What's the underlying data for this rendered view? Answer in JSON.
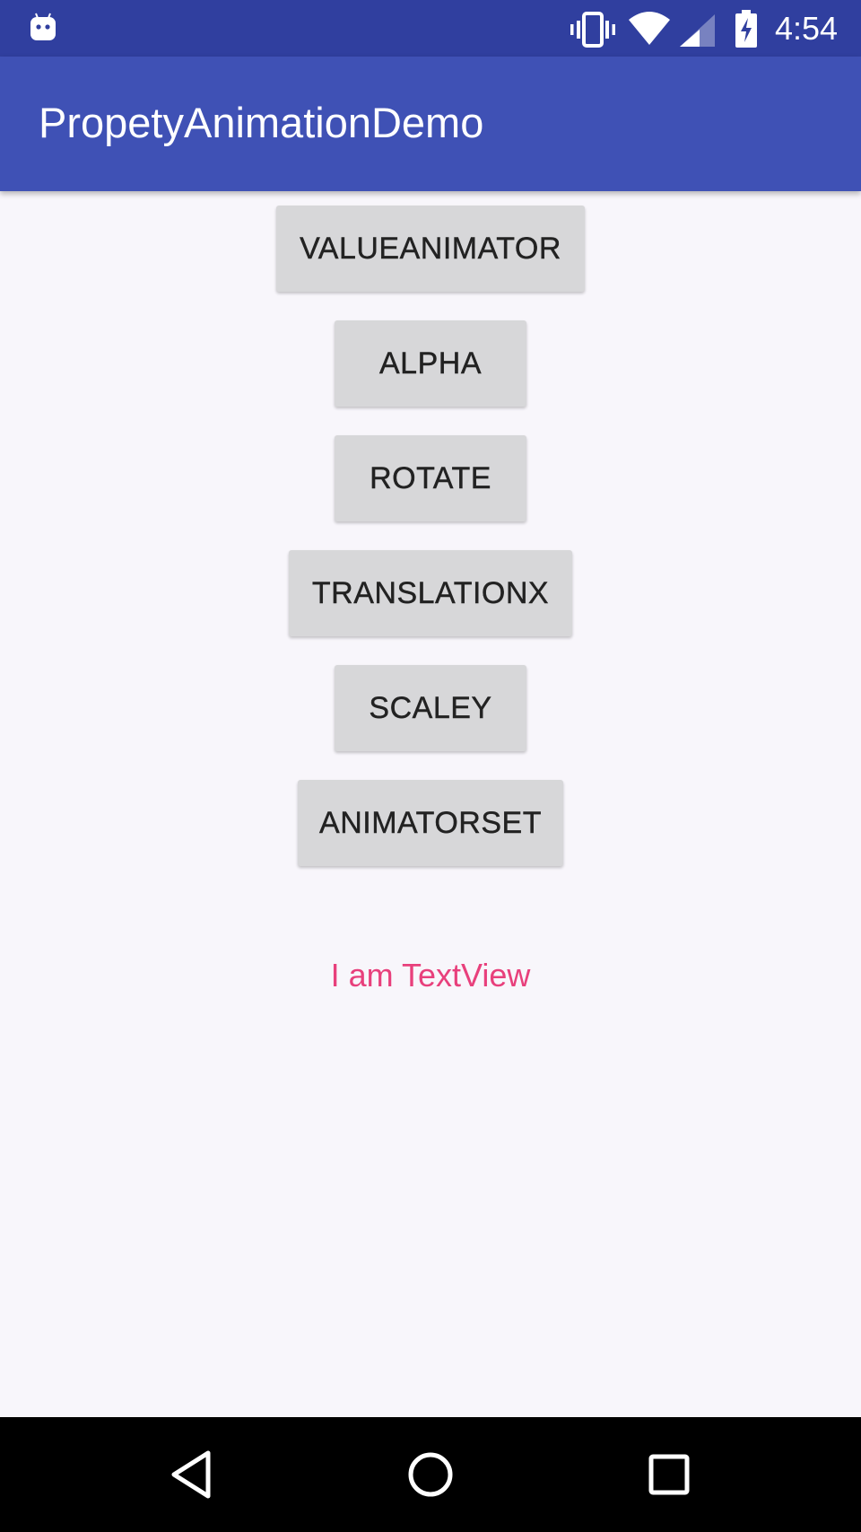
{
  "status_bar": {
    "time": "4:54",
    "icons": [
      "android-icon",
      "vibrate-icon",
      "wifi-icon",
      "signal-icon",
      "battery-charging-icon"
    ]
  },
  "app_bar": {
    "title": "PropetyAnimationDemo"
  },
  "buttons": {
    "value_animator": "VALUEANIMATOR",
    "alpha": "ALPHA",
    "rotate": "ROTATE",
    "translation_x": "TRANSLATIONX",
    "scale_y": "SCALEY",
    "animator_set": "ANIMATORSET"
  },
  "text_view": {
    "text": "I am TextView"
  },
  "nav_bar": {
    "icons": [
      "back-icon",
      "home-icon",
      "recents-icon"
    ]
  },
  "colors": {
    "status_bar": "#303f9f",
    "app_bar": "#3f51b5",
    "background": "#f8f6fb",
    "button": "#d7d7d9",
    "text_view": "#e8407c",
    "nav_bar": "#000000"
  }
}
